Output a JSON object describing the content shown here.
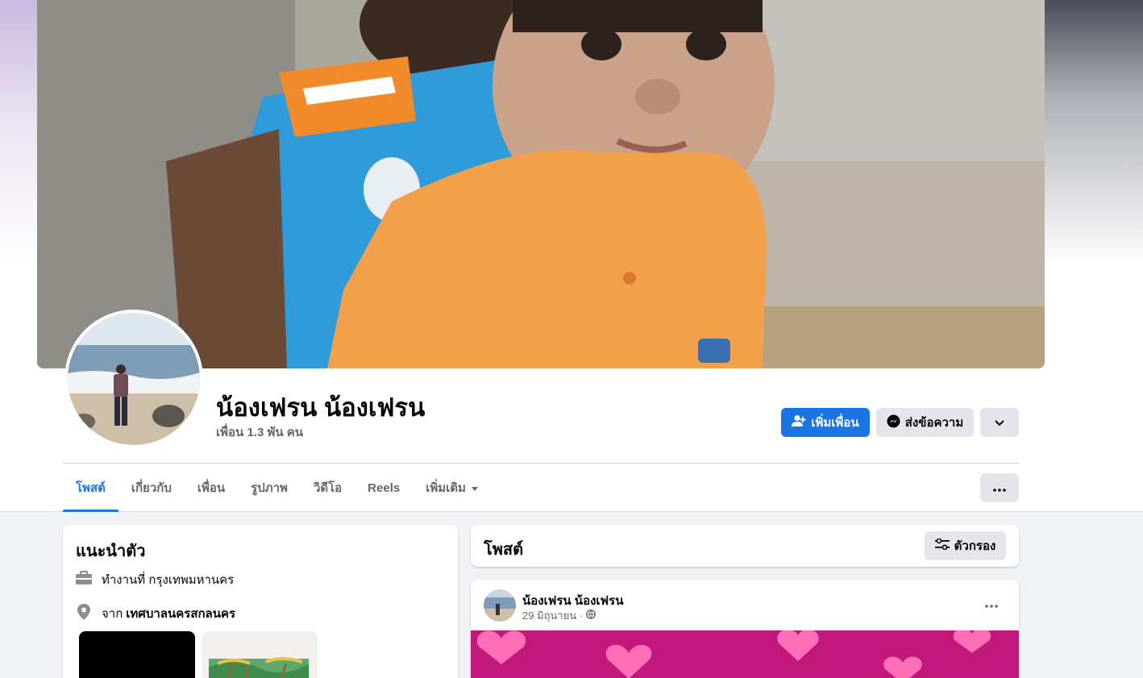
{
  "profile": {
    "name": "น้องเฟรน น้องเฟรน",
    "friends_count": "เพื่อน 1.3 พัน คน"
  },
  "actions": {
    "add_friend": "เพิ่มเพื่อน",
    "message": "ส่งข้อความ"
  },
  "tabs": [
    {
      "label": "โพสต์",
      "active": true
    },
    {
      "label": "เกี่ยวกับ"
    },
    {
      "label": "เพื่อน"
    },
    {
      "label": "รูปภาพ"
    },
    {
      "label": "วิดีโอ"
    },
    {
      "label": "Reels"
    },
    {
      "label": "เพิ่มเติม"
    }
  ],
  "intro": {
    "title": "แนะนำตัว",
    "work": "ทำงานที่ กรุงเทพมหานคร",
    "from_prefix": "จาก",
    "from_place": "เทศบาลนครสกลนคร"
  },
  "posts": {
    "title": "โพสต์",
    "filter_label": "ตัวกรอง",
    "post": {
      "author": "น้องเฟรน น้องเฟรน",
      "date": "29 มิถุนายน ·"
    }
  },
  "colors": {
    "accent": "#1b74e4",
    "post_banner": "#c2177b",
    "heart": "#ff6fb7"
  },
  "icons": [
    "add-friend-icon",
    "messenger-icon",
    "chevron-down-icon",
    "more-icon",
    "filter-icon",
    "briefcase-icon",
    "location-icon",
    "globe-icon"
  ]
}
